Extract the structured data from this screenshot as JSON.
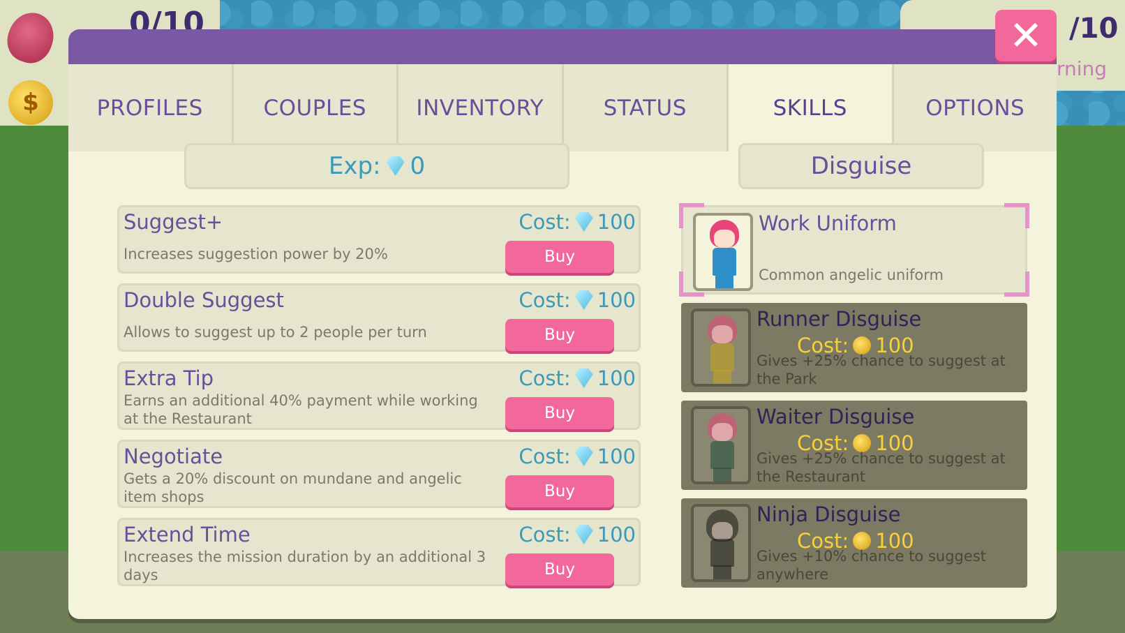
{
  "hud": {
    "left_count": "0/10",
    "right_count": "/10",
    "right_status": "rning"
  },
  "dialog": {
    "close_label": "✕",
    "tabs": [
      {
        "label": "PROFILES"
      },
      {
        "label": "COUPLES"
      },
      {
        "label": "INVENTORY"
      },
      {
        "label": "STATUS"
      },
      {
        "label": "SKILLS",
        "active": true
      },
      {
        "label": "OPTIONS"
      }
    ],
    "exp": {
      "label": "Exp:",
      "value": "0"
    },
    "disguise_title": "Disguise"
  },
  "skills": [
    {
      "name": "Suggest+",
      "cost_label": "Cost:",
      "cost": "100",
      "description": "Increases suggestion power by 20%",
      "buy_label": "Buy"
    },
    {
      "name": "Double Suggest",
      "cost_label": "Cost:",
      "cost": "100",
      "description": "Allows to suggest up to 2 people per turn",
      "buy_label": "Buy"
    },
    {
      "name": "Extra Tip",
      "cost_label": "Cost:",
      "cost": "100",
      "description": "Earns an additional 40% payment while working at the Restaurant",
      "buy_label": "Buy"
    },
    {
      "name": "Negotiate",
      "cost_label": "Cost:",
      "cost": "100",
      "description": "Gets a 20% discount on mundane and angelic item shops",
      "buy_label": "Buy"
    },
    {
      "name": "Extend Time",
      "cost_label": "Cost:",
      "cost": "100",
      "description": "Increases the mission duration by an additional 3 days",
      "buy_label": "Buy"
    }
  ],
  "disguises": [
    {
      "name": "Work Uniform",
      "description": "Common angelic uniform",
      "owned": true,
      "selected": true,
      "outfit_color": "#2e8fc9"
    },
    {
      "name": "Runner Disguise",
      "cost_label": "Cost:",
      "cost": "100",
      "description": "Gives +25% chance to suggest at the Park",
      "owned": false,
      "outfit_color": "#c9a21a"
    },
    {
      "name": "Waiter Disguise",
      "cost_label": "Cost:",
      "cost": "100",
      "description": "Gives +25% chance to suggest at the Restaurant",
      "owned": false,
      "outfit_color": "#1f4a3a"
    },
    {
      "name": "Ninja Disguise",
      "cost_label": "Cost:",
      "cost": "100",
      "description": "Gives +10% chance to suggest anywhere",
      "owned": false,
      "outfit_color": "#1a1a1a"
    }
  ],
  "colors": {
    "accent_purple": "#7b58a4",
    "button_pink": "#f3689a",
    "gem_blue": "#3a9ab8",
    "coin_gold": "#f7d13a",
    "panel_bg": "#f4f3dc"
  }
}
